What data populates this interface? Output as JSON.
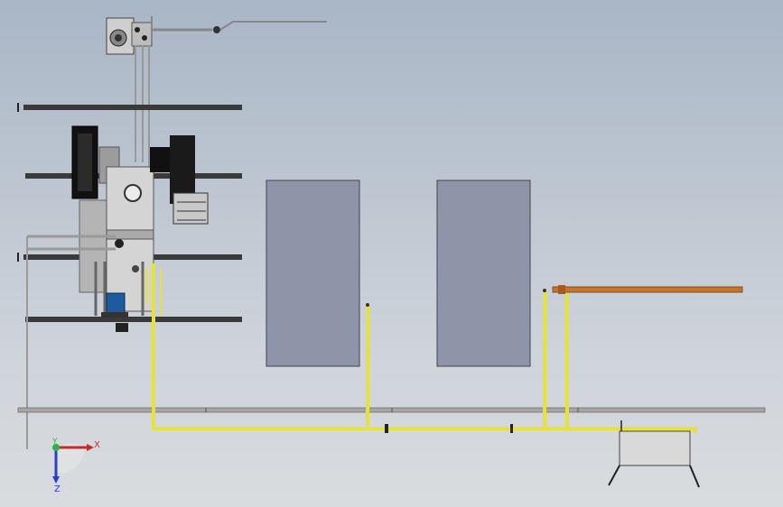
{
  "scene": {
    "background_top": "#a9b6c6",
    "background_bottom": "#d9dcdf",
    "pipe_yellow": "#e6e23a",
    "pipe_orange": "#c8742a",
    "panel_fill": "#8f95a8",
    "beam_color": "#3a3a3a"
  },
  "triad": {
    "x_label": "X",
    "y_label": "Y",
    "z_label": "Z",
    "x_color": "#c42b2b",
    "y_color": "#2fb24a",
    "z_color": "#2b3fc4"
  }
}
